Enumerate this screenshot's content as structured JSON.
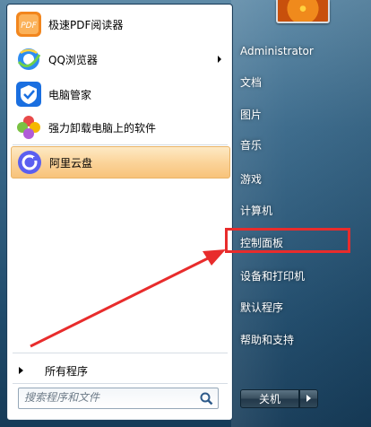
{
  "pinned_programs": [
    {
      "label": "极速PDF阅读器",
      "icon": "pdf-reader-icon"
    },
    {
      "label": "QQ浏览器",
      "icon": "qq-browser-icon",
      "has_submenu": true
    },
    {
      "label": "电脑管家",
      "icon": "pc-manager-icon"
    },
    {
      "label": "强力卸载电脑上的软件",
      "icon": "uninstall-icon"
    },
    {
      "label": "阿里云盘",
      "icon": "aliyun-drive-icon",
      "selected": true
    }
  ],
  "all_programs_label": "所有程序",
  "search": {
    "placeholder": "搜索程序和文件"
  },
  "user": {
    "name": "Administrator"
  },
  "right_items": [
    "文档",
    "图片",
    "音乐",
    "游戏",
    "计算机",
    "控制面板",
    "设备和打印机",
    "默认程序",
    "帮助和支持"
  ],
  "highlighted_item": "控制面板",
  "shutdown_label": "关机",
  "colors": {
    "annotation": "#e82c2c",
    "selection": "#fbd49a"
  }
}
